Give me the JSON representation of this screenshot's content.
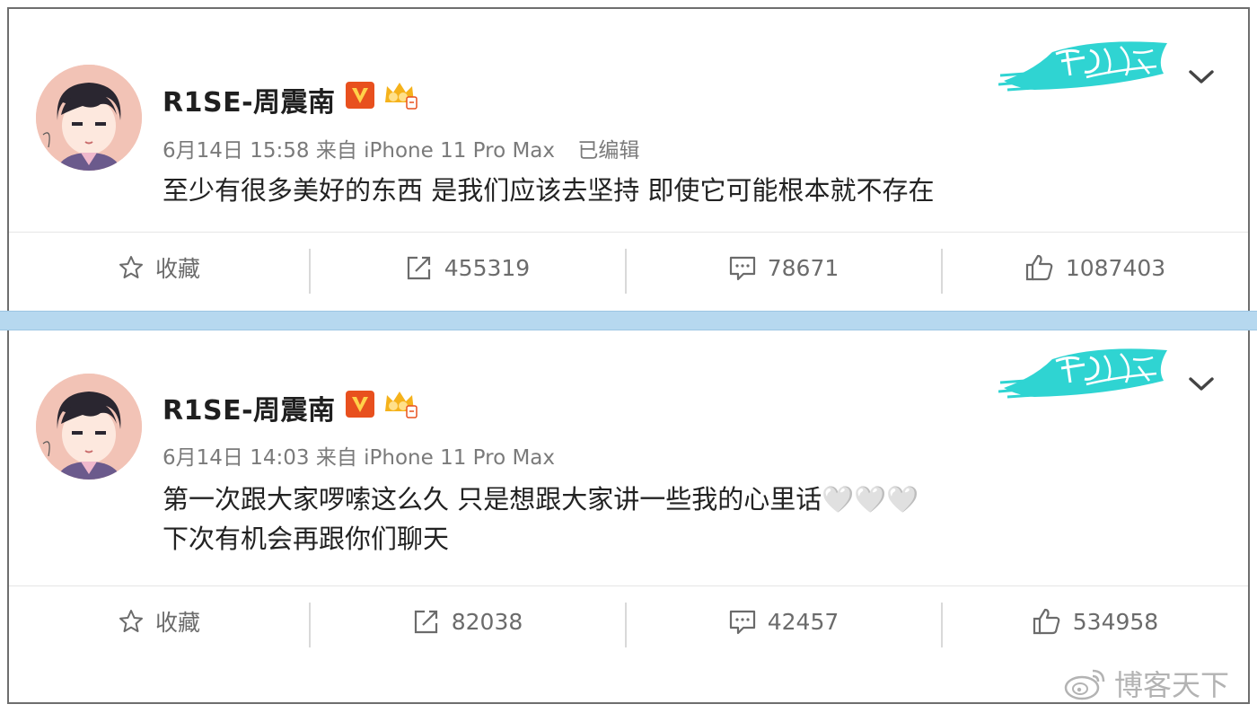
{
  "posts": [
    {
      "username": "R1SE-周震南",
      "timestamp": "6月14日 15:58",
      "source": "来自 iPhone 11 Pro Max",
      "edited": "已编辑",
      "content_lines": [
        "至少有很多美好的东西 是我们应该去坚持 即使它可能根本就不存在"
      ],
      "actions": {
        "favorite": "收藏",
        "reposts": "455319",
        "comments": "78671",
        "likes": "1087403"
      }
    },
    {
      "username": "R1SE-周震南",
      "timestamp": "6月14日 14:03",
      "source": "来自 iPhone 11 Pro Max",
      "edited": "",
      "content_lines": [
        "第一次跟大家啰嗦这么久 只是想跟大家讲一些我的心里话🤍🤍🤍",
        "下次有机会再跟你们聊天"
      ],
      "actions": {
        "favorite": "收藏",
        "reposts": "82038",
        "comments": "42457",
        "likes": "534958"
      }
    }
  ],
  "icons": {
    "verified": "verified-v-icon",
    "member": "crown-member-icon",
    "favorite": "star-icon",
    "repost": "share-icon",
    "comment": "comment-icon",
    "like": "thumbs-up-icon",
    "more": "chevron-down-icon",
    "watermark_logo": "weibo-logo-icon"
  },
  "colors": {
    "verified_badge": "#e8501e",
    "crown": "#f5b21b",
    "decor_badge": "#2fd4d2",
    "divider_band": "#b6d8ef"
  },
  "watermark": "博客天下"
}
